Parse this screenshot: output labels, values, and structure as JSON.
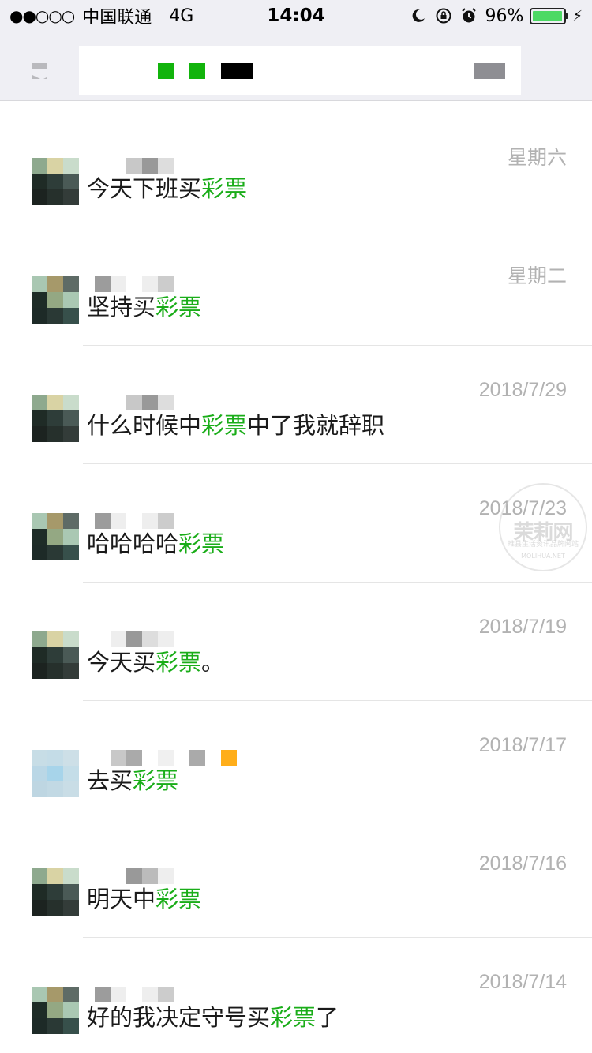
{
  "status_bar": {
    "signal": "●●○○○",
    "carrier": "中国联通",
    "network": "4G",
    "time": "14:04",
    "battery": "96%",
    "battery_level": 0.96,
    "icons": [
      "moon-icon",
      "rotation-lock-icon",
      "alarm-icon",
      "battery-icon",
      "charging-icon"
    ]
  },
  "header": {
    "back_icon": "back-icon"
  },
  "results": [
    {
      "time": "星期六",
      "msg_prefix": "今天下班买",
      "keyword": "彩票",
      "msg_suffix": ""
    },
    {
      "time": "星期二",
      "msg_prefix": "坚持买",
      "keyword": "彩票",
      "msg_suffix": ""
    },
    {
      "time": "2018/7/29",
      "msg_prefix": "什么时候中",
      "keyword": "彩票",
      "msg_suffix": "中了我就辞职"
    },
    {
      "time": "2018/7/23",
      "msg_prefix": "哈哈哈哈",
      "keyword": "彩票",
      "msg_suffix": ""
    },
    {
      "time": "2018/7/19",
      "msg_prefix": "今天买",
      "keyword": "彩票",
      "msg_suffix": "。"
    },
    {
      "time": "2018/7/17",
      "msg_prefix": "去买",
      "keyword": "彩票",
      "msg_suffix": ""
    },
    {
      "time": "2018/7/16",
      "msg_prefix": "明天中",
      "keyword": "彩票",
      "msg_suffix": ""
    },
    {
      "time": "2018/7/14",
      "msg_prefix": "好的我决定守号买",
      "keyword": "彩票",
      "msg_suffix": "了"
    }
  ],
  "colors": {
    "keyword": "#1aad19",
    "timestamp": "#b2b2b2",
    "header_bg": "#efeff4"
  },
  "watermark": {
    "line1": "茉莉网",
    "line2": "睢县生活资讯品牌网站",
    "line3": "MOLIHUA.NET"
  }
}
